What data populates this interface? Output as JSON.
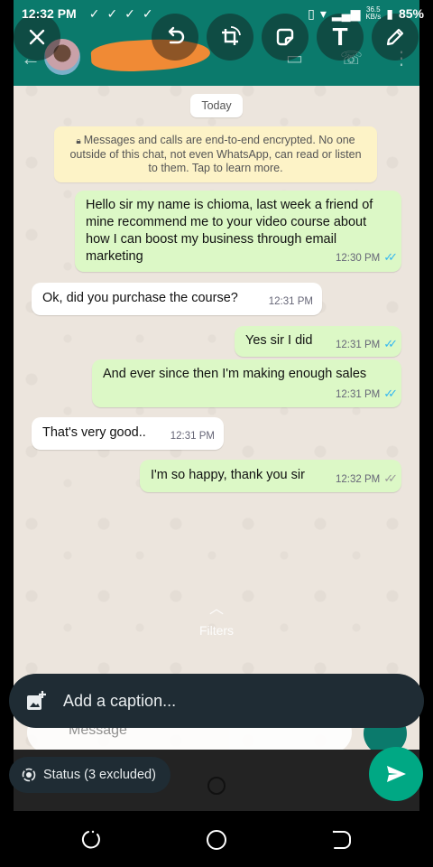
{
  "status_bar": {
    "time": "12:32 PM",
    "net_speed": "36.5",
    "net_unit": "KB/s",
    "battery": "85%"
  },
  "toolbar": {
    "icons": [
      "close-icon",
      "undo-icon",
      "crop-rotate-icon",
      "sticker-icon",
      "text-icon",
      "pencil-icon"
    ],
    "text_tool_label": "T"
  },
  "chat": {
    "date_chip": "Today",
    "encryption_notice": "Messages and calls are end-to-end encrypted. No one outside of this chat, not even WhatsApp, can read or listen to them. Tap to learn more.",
    "messages": [
      {
        "dir": "out",
        "text": "Hello sir my name is chioma, last week a friend of mine recommend me to your video course about how I can boost my business through email marketing",
        "time": "12:30 PM",
        "status": "read"
      },
      {
        "dir": "in",
        "text": "Ok, did you purchase the course?",
        "time": "12:31 PM"
      },
      {
        "dir": "out",
        "text": "Yes sir I did",
        "time": "12:31 PM",
        "status": "read"
      },
      {
        "dir": "out",
        "text": "And ever since then I'm making enough sales",
        "time": "12:31 PM",
        "status": "read"
      },
      {
        "dir": "in",
        "text": "That's very good..",
        "time": "12:31 PM"
      },
      {
        "dir": "out",
        "text": "I'm so happy, thank you sir",
        "time": "12:32 PM",
        "status": "sent"
      }
    ],
    "input_placeholder": "Message"
  },
  "filters_label": "Filters",
  "caption": {
    "placeholder": "Add a caption..."
  },
  "status_pill": {
    "label": "Status (3 excluded)"
  },
  "colors": {
    "wa_header": "#0b7a6c",
    "outgoing_bubble": "#dcf8c6",
    "incoming_bubble": "#ffffff",
    "read_tick": "#34b7f1",
    "send_button": "#00a884",
    "caption_bar": "#1f2c34"
  }
}
